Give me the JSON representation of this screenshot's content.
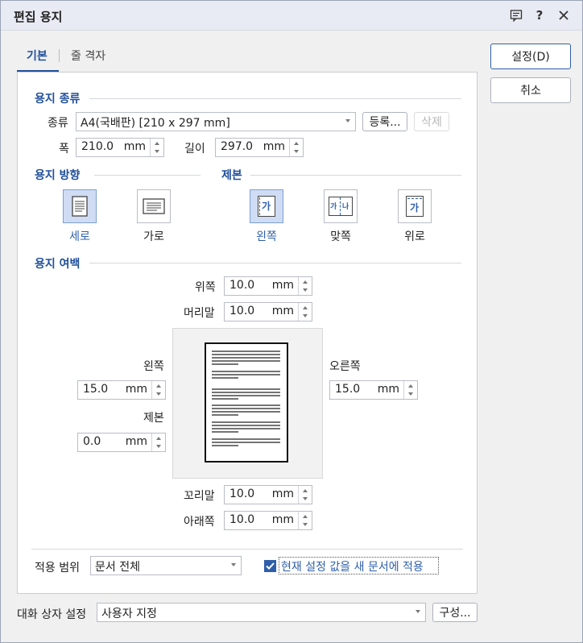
{
  "window": {
    "title": "편집 용지"
  },
  "tabs": [
    {
      "label": "기본"
    },
    {
      "label": "줄 격자"
    }
  ],
  "actions": {
    "ok": "설정(D)",
    "cancel": "취소"
  },
  "paper_type": {
    "section": "용지 종류",
    "kind_label": "종류",
    "kind_value": "A4(국배판)  [210 x 297 mm]",
    "register": "등록...",
    "delete": "삭제",
    "width_label": "폭",
    "width_value": "210.0",
    "height_label": "길이",
    "height_value": "297.0",
    "unit": "mm"
  },
  "orientation": {
    "section": "용지 방향",
    "portrait": "세로",
    "landscape": "가로",
    "selected": "세로"
  },
  "binding": {
    "section": "제본",
    "left": "왼쪽",
    "facing": "맞쪽",
    "top": "위로",
    "selected": "왼쪽",
    "glyph": "가",
    "facing_glyph_left": "가",
    "facing_glyph_right": "나"
  },
  "margins": {
    "section": "용지 여백",
    "top_label": "위쪽",
    "top_value": "10.0",
    "header_label": "머리말",
    "header_value": "10.0",
    "left_label": "왼쪽",
    "left_value": "15.0",
    "right_label": "오른쪽",
    "right_value": "15.0",
    "gutter_label": "제본",
    "gutter_value": "0.0",
    "footer_label": "꼬리말",
    "footer_value": "10.0",
    "bottom_label": "아래쪽",
    "bottom_value": "10.0",
    "unit": "mm"
  },
  "apply": {
    "scope_label": "적용 범위",
    "scope_value": "문서 전체",
    "new_doc_label": "현재 설정 값을 새 문서에 적용",
    "new_doc_checked": true
  },
  "dialog_settings": {
    "label": "대화 상자 설정",
    "value": "사용자 지정",
    "configure": "구성..."
  }
}
